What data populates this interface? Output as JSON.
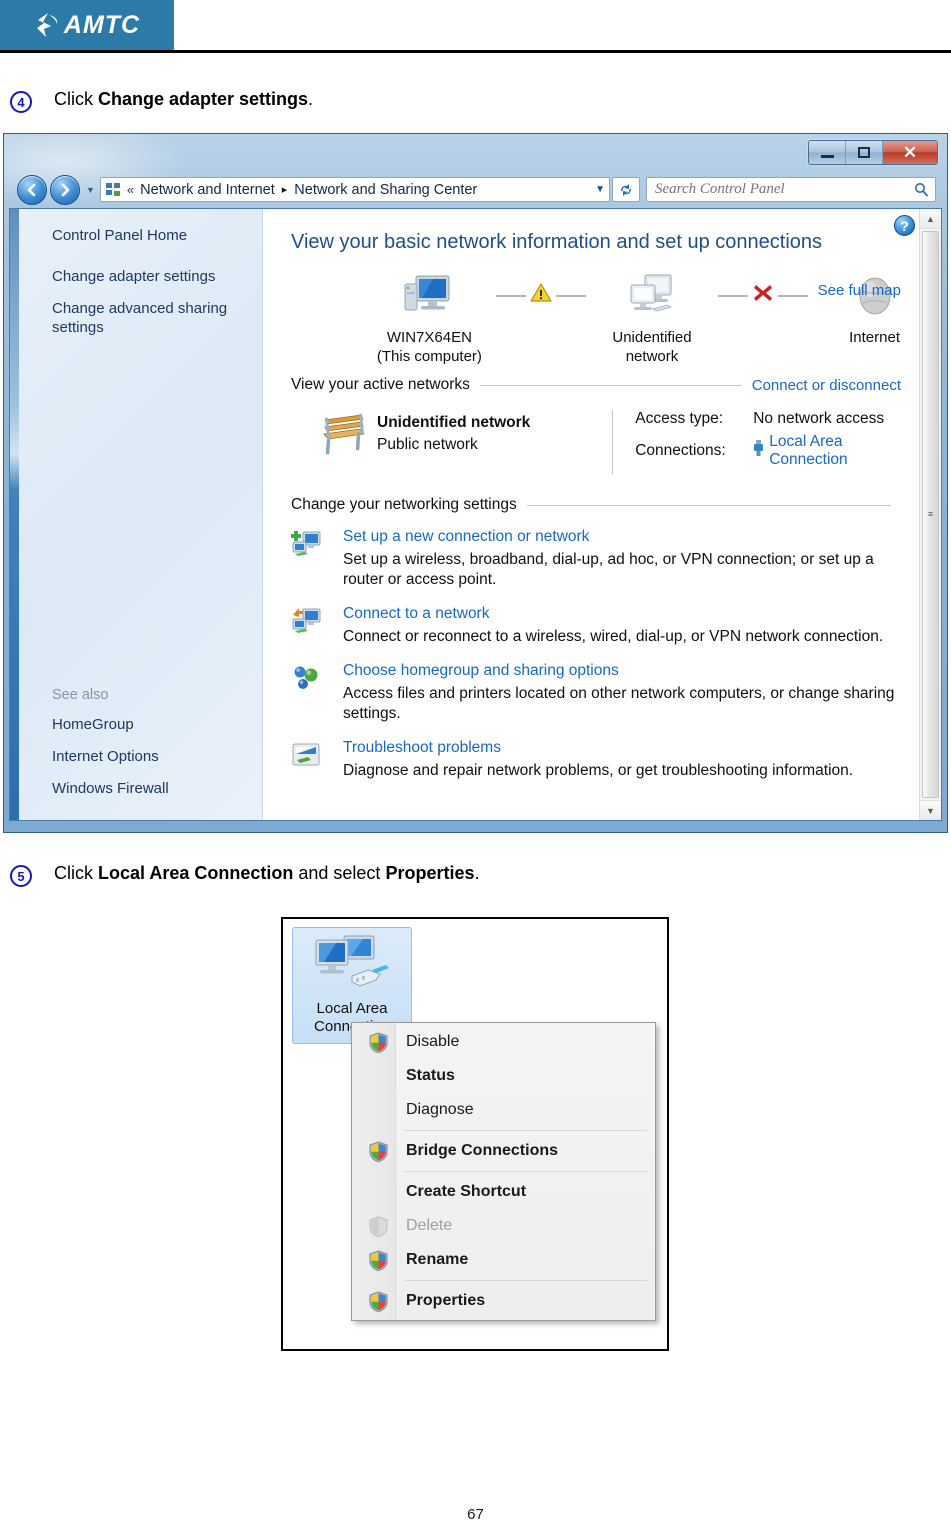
{
  "document": {
    "brand": "AMTC",
    "page_number": "67"
  },
  "steps": [
    {
      "marker": "4",
      "marker_glyph": "④",
      "prefix": "Click ",
      "bold": "Change adapter settings",
      "suffix": "."
    },
    {
      "marker": "5",
      "marker_glyph": "⑤",
      "prefix": "Click ",
      "bold": "Local Area Connection",
      "middle": " and select ",
      "bold2": "Properties",
      "suffix": "."
    }
  ],
  "window": {
    "controls": {
      "minimize": "Minimize",
      "maximize": "Maximize",
      "close": "Close",
      "close_glyph": "✕"
    },
    "nav": {
      "back": "Back",
      "forward": "Forward",
      "recent_pages": "Recent pages",
      "overflow_glyph": "«",
      "breadcrumb": [
        "Network and Internet",
        "Network and Sharing Center"
      ],
      "breadcrumb_separator": "▸",
      "dropdown_glyph": "▼",
      "refresh": "Refresh",
      "refresh_glyph": "⟳"
    },
    "search": {
      "placeholder": "Search Control Panel",
      "value": "",
      "icon": "search-icon"
    },
    "help": {
      "label": "?",
      "title": "Help"
    }
  },
  "sidebar": {
    "items": [
      {
        "label": "Control Panel Home"
      },
      {
        "label": "Change adapter settings"
      },
      {
        "label": "Change advanced sharing settings"
      }
    ],
    "see_also": {
      "title": "See also",
      "items": [
        {
          "label": "HomeGroup"
        },
        {
          "label": "Internet Options"
        },
        {
          "label": "Windows Firewall"
        }
      ]
    }
  },
  "content": {
    "heading": "View your basic network information and set up connections",
    "see_full_map": "See full map",
    "network_map": {
      "nodes": [
        {
          "icon": "computer-icon",
          "label_line1": "WIN7X64EN",
          "label_line2": "(This computer)"
        },
        {
          "icon": "multiple-computers-icon",
          "label_line1": "Unidentified network",
          "label_line2": ""
        },
        {
          "icon": "globe-icon",
          "label_line1": "Internet",
          "label_line2": ""
        }
      ],
      "connectors": [
        {
          "status": "warning",
          "icon": "warning-triangle-icon"
        },
        {
          "status": "error",
          "icon": "red-x-icon"
        }
      ]
    },
    "active_networks": {
      "section_title": "View your active networks",
      "right_link": "Connect or disconnect",
      "network": {
        "icon": "park-bench-icon",
        "name": "Unidentified network",
        "type": "Public network",
        "access_type_label": "Access type:",
        "access_type_value": "No network access",
        "connections_label": "Connections:",
        "connections_value": "Local Area Connection",
        "connections_icon": "network-plug-icon"
      }
    },
    "networking_settings": {
      "section_title": "Change your networking settings",
      "items": [
        {
          "icon": "new-connection-icon",
          "title": "Set up a new connection or network",
          "desc": "Set up a wireless, broadband, dial-up, ad hoc, or VPN connection; or set up a router or access point."
        },
        {
          "icon": "connect-network-icon",
          "title": "Connect to a network",
          "desc": "Connect or reconnect to a wireless, wired, dial-up, or VPN network connection."
        },
        {
          "icon": "homegroup-icon",
          "title": "Choose homegroup and sharing options",
          "desc": "Access files and printers located on other network computers, or change sharing settings."
        },
        {
          "icon": "troubleshoot-icon",
          "title": "Troubleshoot problems",
          "desc": "Diagnose and repair network problems, or get troubleshooting information."
        }
      ]
    },
    "scrollbar": {
      "up_glyph": "▲",
      "down_glyph": "▼",
      "grip": "≡"
    }
  },
  "context_screenshot": {
    "tile": {
      "icon": "local-area-connection-icon",
      "label_line1": "Local Area",
      "label_line2": "Connection"
    },
    "menu": [
      {
        "label": "Disable",
        "icon": "shield-icon",
        "bold": false,
        "disabled": false
      },
      {
        "label": "Status",
        "icon": "",
        "bold": true,
        "disabled": false
      },
      {
        "label": "Diagnose",
        "icon": "",
        "bold": false,
        "disabled": false
      },
      {
        "separator": true
      },
      {
        "label": "Bridge Connections",
        "icon": "shield-icon",
        "bold": true,
        "disabled": false
      },
      {
        "separator": true
      },
      {
        "label": "Create Shortcut",
        "icon": "",
        "bold": true,
        "disabled": false
      },
      {
        "label": "Delete",
        "icon": "shield-disabled-icon",
        "bold": false,
        "disabled": true
      },
      {
        "label": "Rename",
        "icon": "shield-icon",
        "bold": true,
        "disabled": false
      },
      {
        "separator": true
      },
      {
        "label": "Properties",
        "icon": "shield-icon",
        "bold": true,
        "disabled": false
      }
    ]
  },
  "colors": {
    "brand_blue": "#2b7aa8",
    "link_blue": "#1569c7",
    "heading_blue": "#1f4e8c",
    "sidebar_text": "#1f3864",
    "step_marker": "#1414c8"
  }
}
